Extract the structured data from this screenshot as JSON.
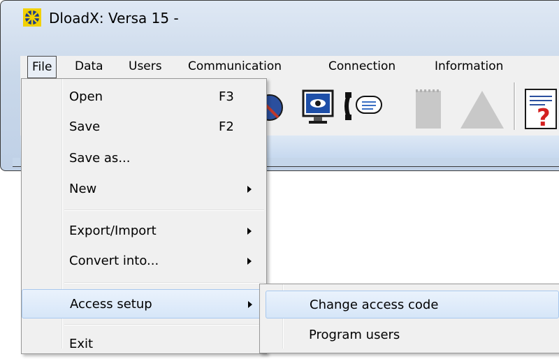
{
  "window": {
    "title": "DloadX: Versa 15 -"
  },
  "menubar": {
    "items": [
      {
        "label": "File"
      },
      {
        "label": "Data"
      },
      {
        "label": "Users"
      },
      {
        "label": "Communication"
      },
      {
        "label": "Connection"
      },
      {
        "label": "Information"
      }
    ]
  },
  "file_menu": {
    "items": [
      {
        "label": "Open",
        "shortcut": "F3"
      },
      {
        "label": "Save",
        "shortcut": "F2"
      },
      {
        "label": "Save as..."
      },
      {
        "label": "New"
      },
      {
        "label": "Export/Import"
      },
      {
        "label": "Convert into..."
      },
      {
        "label": "Access setup"
      },
      {
        "label": "Exit"
      }
    ]
  },
  "access_submenu": {
    "items": [
      {
        "label": "Change access code"
      },
      {
        "label": "Program users"
      }
    ]
  },
  "toolbar": {
    "icons": [
      "globe-icon",
      "monitor-eye-icon",
      "phone-message-icon",
      "document-icon",
      "triangle-icon",
      "help-document-icon"
    ]
  },
  "colors": {
    "menu_highlight": "#d6e6f8",
    "window_frame": "#c9d8ea"
  }
}
